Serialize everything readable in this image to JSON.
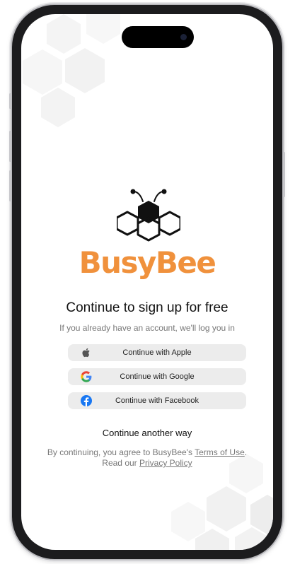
{
  "brand": {
    "name": "BusyBee",
    "accent": "#f0913c"
  },
  "headline": "Continue to sign up for free",
  "subline": "If you already have an account, we'll log you in",
  "auth_buttons": [
    {
      "label": "Continue with Apple",
      "icon": "apple-icon"
    },
    {
      "label": "Continue with Google",
      "icon": "google-icon"
    },
    {
      "label": "Continue with Facebook",
      "icon": "facebook-icon"
    }
  ],
  "continue_another": "Continue another way",
  "legal": {
    "prefix": "By continuing, you agree to BusyBee's ",
    "terms": "Terms of Use",
    "suffix": ".",
    "read": "Read our ",
    "privacy": "Privacy Policy"
  }
}
